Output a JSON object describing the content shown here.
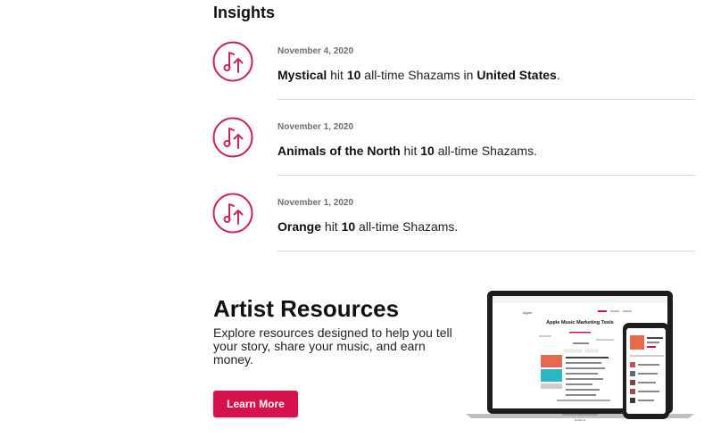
{
  "insights": {
    "title": "Insights",
    "items": [
      {
        "date": "November 4, 2020",
        "subject": "Mystical",
        "text1": " hit ",
        "count": "10",
        "text2": " all-time Shazams in ",
        "location": "United States",
        "text3": "."
      },
      {
        "date": "November 1, 2020",
        "subject": "Animals of the North",
        "text1": " hit ",
        "count": "10",
        "text2": " all-time Shazams.",
        "location": "",
        "text3": ""
      },
      {
        "date": "November 1, 2020",
        "subject": "Orange",
        "text1": " hit ",
        "count": "10",
        "text2": " all-time Shazams.",
        "location": "",
        "text3": ""
      }
    ],
    "icon": "music-note-up-arrow-icon",
    "accent_color": "#c8255b"
  },
  "resources": {
    "title": "Artist Resources",
    "description": "Explore resources designed to help you tell your story, share your music, and earn money.",
    "button_label": "Learn More",
    "button_color": "#d6124c",
    "art": {
      "screen_title": "Apple Music Marketing Tools",
      "brand": "Apple",
      "laptop_label": "MacBook"
    }
  }
}
